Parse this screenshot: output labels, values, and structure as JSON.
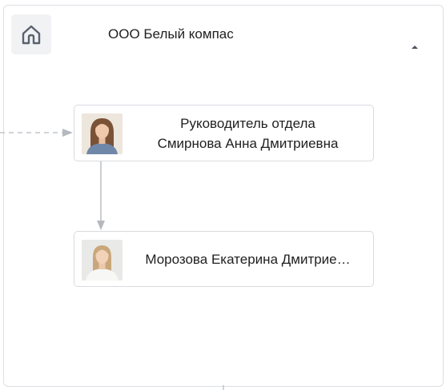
{
  "header": {
    "org_name": "ООО Белый компас",
    "home_icon": "home-icon",
    "toggle_icon": "caret-up-icon"
  },
  "nodes": [
    {
      "role": "Руководитель отдела",
      "name": "Смирнова Анна Дмитриевна",
      "avatar_icon": "person-photo-icon"
    },
    {
      "name": "Морозова Екатерина Дмитрие…",
      "avatar_icon": "person-photo-icon"
    }
  ],
  "colors": {
    "border": "#dcdfe4",
    "connector": "#b5b9bf",
    "text": "#1f1f1f",
    "home_bg": "#f1f2f4",
    "icon": "#5a6270"
  }
}
